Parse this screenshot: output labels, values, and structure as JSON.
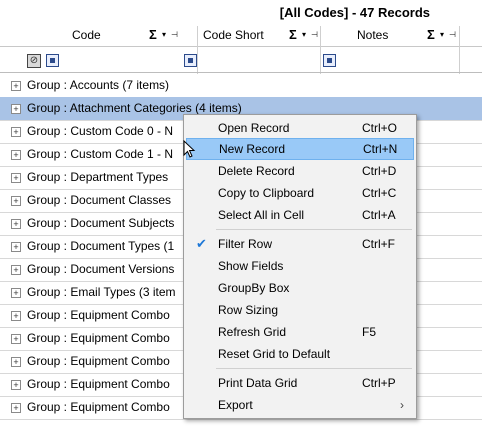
{
  "header": {
    "title": "[All Codes] - 47 Records"
  },
  "columns": [
    {
      "label": "Code",
      "sigma": "Σ",
      "chev": "▾",
      "pin": "⊣"
    },
    {
      "label": "Code Short",
      "sigma": "Σ",
      "chev": "▾",
      "pin": "⊣"
    },
    {
      "label": "Notes",
      "sigma": "Σ",
      "chev": "▾",
      "pin": "⊣"
    }
  ],
  "groups": [
    "Group : Accounts (7 items)",
    "Group : Attachment Categories (4 items)",
    "Group : Custom Code 0 - N",
    "Group : Custom Code 1 - N",
    "Group : Department Types",
    "Group : Document Classes",
    "Group : Document Subjects",
    "Group : Document Types (1",
    "Group : Document Versions",
    "Group : Email Types (3 item",
    "Group : Equipment Combo",
    "Group : Equipment Combo",
    "Group : Equipment Combo",
    "Group : Equipment Combo",
    "Group : Equipment Combo"
  ],
  "expander_glyph": "+",
  "context_menu": {
    "items": [
      {
        "label": "Open Record",
        "shortcut": "Ctrl+O"
      },
      {
        "label": "New Record",
        "shortcut": "Ctrl+N"
      },
      {
        "label": "Delete Record",
        "shortcut": "Ctrl+D"
      },
      {
        "label": "Copy to Clipboard",
        "shortcut": "Ctrl+C"
      },
      {
        "label": "Select All in Cell",
        "shortcut": "Ctrl+A"
      },
      {
        "label": "Filter Row",
        "shortcut": "Ctrl+F",
        "checked": true,
        "check_glyph": "✔"
      },
      {
        "label": "Show Fields",
        "shortcut": ""
      },
      {
        "label": "GroupBy Box",
        "shortcut": ""
      },
      {
        "label": "Row Sizing",
        "shortcut": ""
      },
      {
        "label": "Refresh Grid",
        "shortcut": "F5"
      },
      {
        "label": "Reset Grid to Default",
        "shortcut": ""
      },
      {
        "label": "Print Data Grid",
        "shortcut": "Ctrl+P"
      },
      {
        "label": "Export",
        "shortcut": "",
        "submenu_glyph": "›"
      }
    ],
    "highlighted_index": 1
  },
  "colors": {
    "selected_row": "#a9c3e6",
    "menu_highlight": "#99c9f7"
  }
}
